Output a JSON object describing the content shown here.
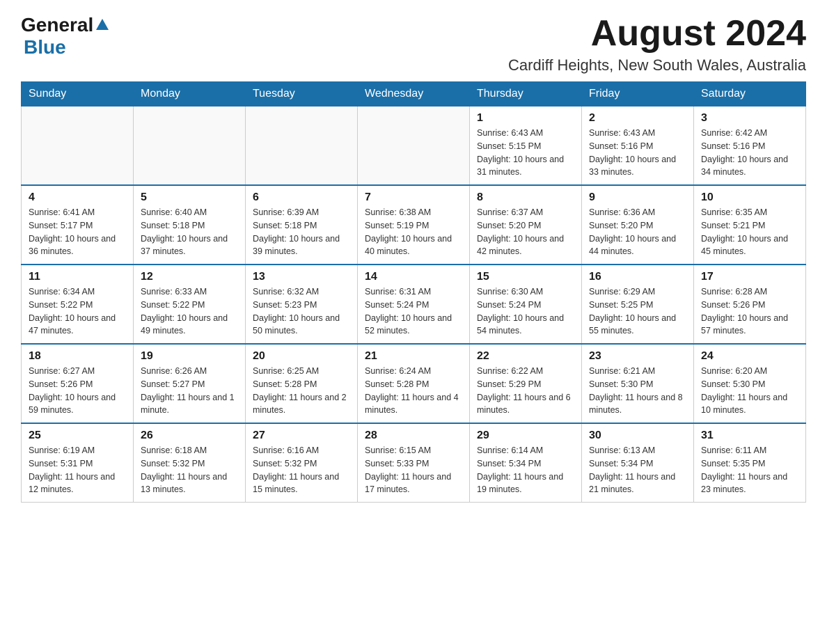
{
  "header": {
    "logo_general": "General",
    "logo_arrow": "▲",
    "logo_blue": "Blue",
    "month_title": "August 2024",
    "location": "Cardiff Heights, New South Wales, Australia"
  },
  "days_of_week": [
    "Sunday",
    "Monday",
    "Tuesday",
    "Wednesday",
    "Thursday",
    "Friday",
    "Saturday"
  ],
  "weeks": [
    [
      {
        "day": "",
        "info": ""
      },
      {
        "day": "",
        "info": ""
      },
      {
        "day": "",
        "info": ""
      },
      {
        "day": "",
        "info": ""
      },
      {
        "day": "1",
        "info": "Sunrise: 6:43 AM\nSunset: 5:15 PM\nDaylight: 10 hours and 31 minutes."
      },
      {
        "day": "2",
        "info": "Sunrise: 6:43 AM\nSunset: 5:16 PM\nDaylight: 10 hours and 33 minutes."
      },
      {
        "day": "3",
        "info": "Sunrise: 6:42 AM\nSunset: 5:16 PM\nDaylight: 10 hours and 34 minutes."
      }
    ],
    [
      {
        "day": "4",
        "info": "Sunrise: 6:41 AM\nSunset: 5:17 PM\nDaylight: 10 hours and 36 minutes."
      },
      {
        "day": "5",
        "info": "Sunrise: 6:40 AM\nSunset: 5:18 PM\nDaylight: 10 hours and 37 minutes."
      },
      {
        "day": "6",
        "info": "Sunrise: 6:39 AM\nSunset: 5:18 PM\nDaylight: 10 hours and 39 minutes."
      },
      {
        "day": "7",
        "info": "Sunrise: 6:38 AM\nSunset: 5:19 PM\nDaylight: 10 hours and 40 minutes."
      },
      {
        "day": "8",
        "info": "Sunrise: 6:37 AM\nSunset: 5:20 PM\nDaylight: 10 hours and 42 minutes."
      },
      {
        "day": "9",
        "info": "Sunrise: 6:36 AM\nSunset: 5:20 PM\nDaylight: 10 hours and 44 minutes."
      },
      {
        "day": "10",
        "info": "Sunrise: 6:35 AM\nSunset: 5:21 PM\nDaylight: 10 hours and 45 minutes."
      }
    ],
    [
      {
        "day": "11",
        "info": "Sunrise: 6:34 AM\nSunset: 5:22 PM\nDaylight: 10 hours and 47 minutes."
      },
      {
        "day": "12",
        "info": "Sunrise: 6:33 AM\nSunset: 5:22 PM\nDaylight: 10 hours and 49 minutes."
      },
      {
        "day": "13",
        "info": "Sunrise: 6:32 AM\nSunset: 5:23 PM\nDaylight: 10 hours and 50 minutes."
      },
      {
        "day": "14",
        "info": "Sunrise: 6:31 AM\nSunset: 5:24 PM\nDaylight: 10 hours and 52 minutes."
      },
      {
        "day": "15",
        "info": "Sunrise: 6:30 AM\nSunset: 5:24 PM\nDaylight: 10 hours and 54 minutes."
      },
      {
        "day": "16",
        "info": "Sunrise: 6:29 AM\nSunset: 5:25 PM\nDaylight: 10 hours and 55 minutes."
      },
      {
        "day": "17",
        "info": "Sunrise: 6:28 AM\nSunset: 5:26 PM\nDaylight: 10 hours and 57 minutes."
      }
    ],
    [
      {
        "day": "18",
        "info": "Sunrise: 6:27 AM\nSunset: 5:26 PM\nDaylight: 10 hours and 59 minutes."
      },
      {
        "day": "19",
        "info": "Sunrise: 6:26 AM\nSunset: 5:27 PM\nDaylight: 11 hours and 1 minute."
      },
      {
        "day": "20",
        "info": "Sunrise: 6:25 AM\nSunset: 5:28 PM\nDaylight: 11 hours and 2 minutes."
      },
      {
        "day": "21",
        "info": "Sunrise: 6:24 AM\nSunset: 5:28 PM\nDaylight: 11 hours and 4 minutes."
      },
      {
        "day": "22",
        "info": "Sunrise: 6:22 AM\nSunset: 5:29 PM\nDaylight: 11 hours and 6 minutes."
      },
      {
        "day": "23",
        "info": "Sunrise: 6:21 AM\nSunset: 5:30 PM\nDaylight: 11 hours and 8 minutes."
      },
      {
        "day": "24",
        "info": "Sunrise: 6:20 AM\nSunset: 5:30 PM\nDaylight: 11 hours and 10 minutes."
      }
    ],
    [
      {
        "day": "25",
        "info": "Sunrise: 6:19 AM\nSunset: 5:31 PM\nDaylight: 11 hours and 12 minutes."
      },
      {
        "day": "26",
        "info": "Sunrise: 6:18 AM\nSunset: 5:32 PM\nDaylight: 11 hours and 13 minutes."
      },
      {
        "day": "27",
        "info": "Sunrise: 6:16 AM\nSunset: 5:32 PM\nDaylight: 11 hours and 15 minutes."
      },
      {
        "day": "28",
        "info": "Sunrise: 6:15 AM\nSunset: 5:33 PM\nDaylight: 11 hours and 17 minutes."
      },
      {
        "day": "29",
        "info": "Sunrise: 6:14 AM\nSunset: 5:34 PM\nDaylight: 11 hours and 19 minutes."
      },
      {
        "day": "30",
        "info": "Sunrise: 6:13 AM\nSunset: 5:34 PM\nDaylight: 11 hours and 21 minutes."
      },
      {
        "day": "31",
        "info": "Sunrise: 6:11 AM\nSunset: 5:35 PM\nDaylight: 11 hours and 23 minutes."
      }
    ]
  ]
}
